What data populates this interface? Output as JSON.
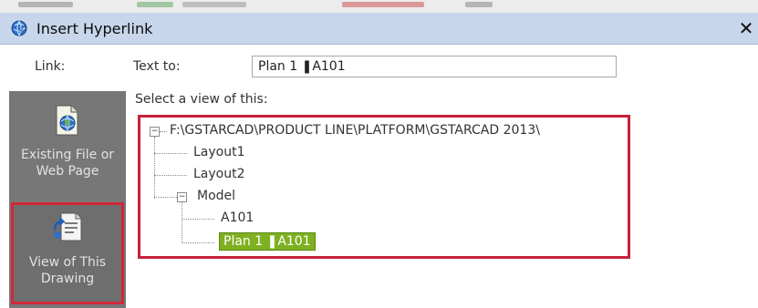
{
  "dialog": {
    "title": "Insert Hyperlink",
    "close_glyph": "✕",
    "title_icon": "hyperlink-globe-icon"
  },
  "link": {
    "label": "Link:",
    "text_to_label": "Text to:",
    "text_to_value": "Plan 1 ❚A101",
    "select_view_label": "Select a view of this:"
  },
  "places": [
    {
      "label_line1": "Existing File or",
      "label_line2": "Web Page",
      "icon": "file-globe-icon",
      "selected": false
    },
    {
      "label_line1": "View of This",
      "label_line2": "Drawing",
      "icon": "drawing-view-icon",
      "selected": true
    }
  ],
  "tree": {
    "root": "F:\\GSTARCAD\\PRODUCT LINE\\PLATFORM\\GSTARCAD 2013\\",
    "layout1": "Layout1",
    "layout2": "Layout2",
    "model": "Model",
    "a101": "A101",
    "plan": "Plan 1 ❚A101",
    "expander_open": "−"
  },
  "colors": {
    "titlebar": "#c7d6ea",
    "highlight_border": "#c8203a",
    "selected_node": "#7fb021",
    "places_bar": "#777777"
  }
}
